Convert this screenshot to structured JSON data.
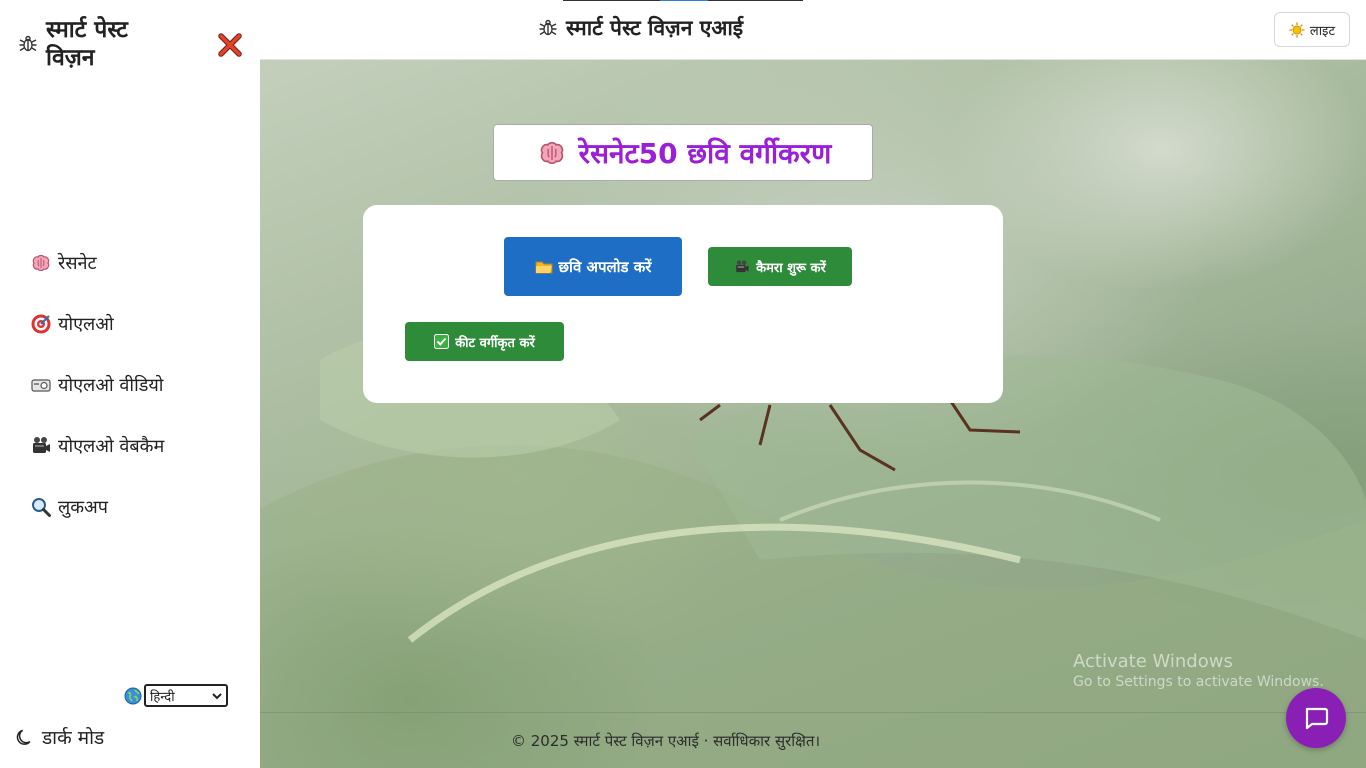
{
  "header": {
    "title": "स्मार्ट पेस्ट विज़न एआई",
    "theme_button": "लाइट"
  },
  "sidebar": {
    "brand_line1": "स्मार्ट पेस्ट",
    "brand_line2": "विज़न",
    "items": [
      {
        "label": "रेसनेट",
        "icon": "brain-icon"
      },
      {
        "label": "योएलओ",
        "icon": "target-icon"
      },
      {
        "label": "योएलओ वीडियो",
        "icon": "projector-icon"
      },
      {
        "label": "योएलओ वेबकैम",
        "icon": "camera-icon"
      },
      {
        "label": "लुकअप",
        "icon": "magnifier-icon"
      }
    ],
    "language": {
      "selected": "हिन्दी"
    },
    "dark_mode_label": "डार्क मोड"
  },
  "main": {
    "title": "रेसनेट50 छवि वर्गीकरण",
    "upload_button": "छवि अपलोड करें",
    "camera_button": "कैमरा शुरू करें",
    "classify_button": "कीट वर्गीकृत करें"
  },
  "footer": {
    "text": "© 2025 स्मार्ट पेस्ट विज़न एआई · सर्वाधिकार सुरक्षित।"
  },
  "watermark": {
    "line1": "Activate Windows",
    "line2": "Go to Settings to activate Windows."
  },
  "colors": {
    "accent_purple": "#9b1fd6",
    "upload_blue": "#1e6ec6",
    "action_green": "#2e8b3a",
    "chat_purple": "#8a1fb6"
  }
}
